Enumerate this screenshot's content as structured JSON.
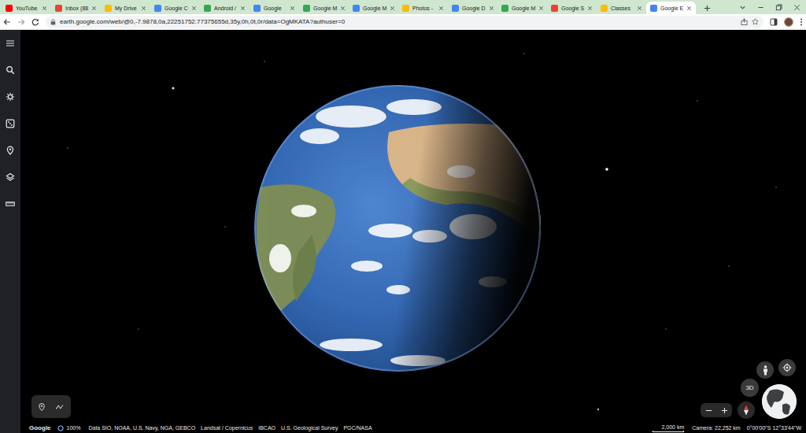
{
  "browser": {
    "tabs": [
      {
        "label": "YouTube",
        "selected": false,
        "color": "#ff0000"
      },
      {
        "label": "Inbox (88",
        "selected": false,
        "color": "#ea4335"
      },
      {
        "label": "My Drive",
        "selected": false,
        "color": "#fbbc04"
      },
      {
        "label": "Google C",
        "selected": false,
        "color": "#4285f4"
      },
      {
        "label": "Android /",
        "selected": false,
        "color": "#34a853"
      },
      {
        "label": "Google",
        "selected": false,
        "color": "#4285f4"
      },
      {
        "label": "Google M",
        "selected": false,
        "color": "#34a853"
      },
      {
        "label": "Google M",
        "selected": false,
        "color": "#4285f4"
      },
      {
        "label": "Photos -",
        "selected": false,
        "color": "#fbbc04"
      },
      {
        "label": "Google D",
        "selected": false,
        "color": "#4285f4"
      },
      {
        "label": "Google M",
        "selected": false,
        "color": "#34a853"
      },
      {
        "label": "Google S",
        "selected": false,
        "color": "#ea4335"
      },
      {
        "label": "Classes",
        "selected": false,
        "color": "#fbbc04"
      },
      {
        "label": "Google E",
        "selected": true,
        "color": "#4285f4"
      }
    ],
    "address_bar": {
      "url": "earth.google.com/web/@0,-7.9878,0a,22251752.77375655d,35y,0h,0t,0r/data=OgMKATA?authuser=0"
    }
  },
  "earth": {
    "view_toggle": "3D",
    "status_bar": {
      "logo": "Google",
      "progress": "100%",
      "attribution": [
        "Data SIO, NOAA, U.S. Navy, NGA, GEBCO",
        "Landsat / Copernicus",
        "IBCAO",
        "U.S. Geological Survey",
        "PGC/NASA"
      ],
      "scale": "2,000 km",
      "camera": "Camera: 22,252 km",
      "coordinates": "0°00'00\"S 12°33'44\"W"
    }
  }
}
